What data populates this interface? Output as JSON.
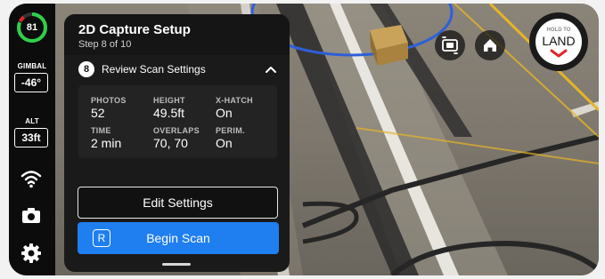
{
  "status": {
    "battery_percent": "81",
    "gimbal_label": "GIMBAL",
    "gimbal_value": "-46°",
    "alt_label": "ALT",
    "alt_value": "33ft"
  },
  "sidebar_icons": [
    "wifi-icon",
    "camera-icon",
    "gear-icon"
  ],
  "panel": {
    "title": "2D Capture Setup",
    "subtitle": "Step 8 of 10",
    "section_number": "8",
    "section_title": "Review Scan Settings",
    "stats": [
      {
        "label": "PHOTOS",
        "value": "52"
      },
      {
        "label": "HEIGHT",
        "value": "49.5ft"
      },
      {
        "label": "X-HATCH",
        "value": "On"
      },
      {
        "label": "TIME",
        "value": "2 min"
      },
      {
        "label": "OVERLAPS",
        "value": "70, 70"
      },
      {
        "label": "PERIM.",
        "value": "On"
      }
    ],
    "edit_button": "Edit Settings",
    "begin_button": "Begin Scan",
    "begin_icon_letter": "R"
  },
  "top_controls": {
    "hold_to": "HOLD TO",
    "land": "LAND"
  },
  "colors": {
    "accent_blue": "#1f7ef0",
    "battery_green": "#2ed14a",
    "land_red": "#e0262a"
  }
}
